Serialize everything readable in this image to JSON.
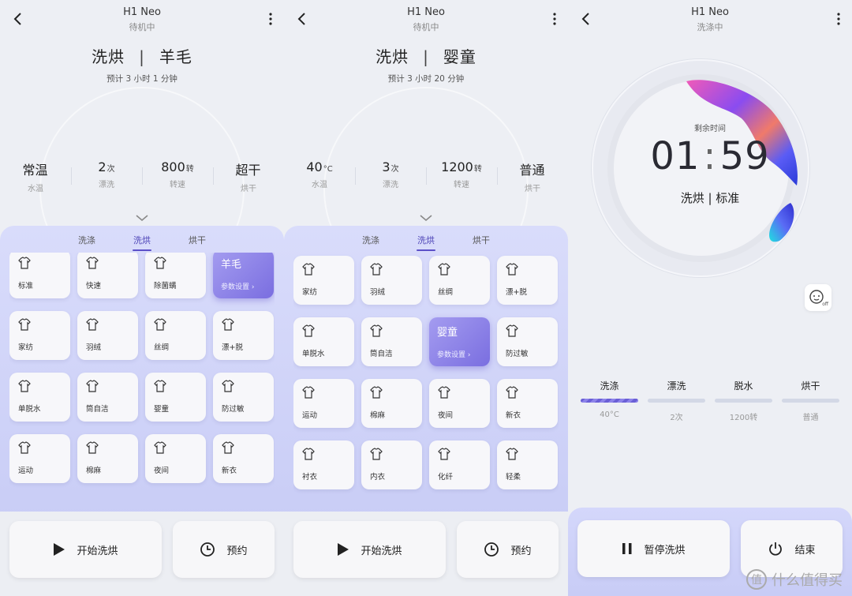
{
  "screen1": {
    "device": "H1 Neo",
    "status": "待机中",
    "mode_main": "洗烘",
    "mode_sub": "羊毛",
    "estimate": "预计 3 小时 1 分钟",
    "params": [
      {
        "value": "常温",
        "unit": "",
        "label": "水温"
      },
      {
        "value": "2",
        "unit": "次",
        "label": "漂洗"
      },
      {
        "value": "800",
        "unit": "转",
        "label": "转速"
      },
      {
        "value": "超干",
        "unit": "",
        "label": "烘干"
      }
    ],
    "tabs": [
      "洗涤",
      "洗烘",
      "烘干"
    ],
    "active_tab": "洗烘",
    "programs": [
      "标准",
      "快速",
      "除菌螨",
      "羊毛",
      "家纺",
      "羽绒",
      "丝绸",
      "漂+脱",
      "单脱水",
      "筒自洁",
      "婴童",
      "防过敏",
      "运动",
      "棉麻",
      "夜间",
      "新衣"
    ],
    "selected": {
      "name": "羊毛",
      "sub": "参数设置 ›"
    },
    "start_label": "开始洗烘",
    "reserve_label": "预约"
  },
  "screen2": {
    "device": "H1 Neo",
    "status": "待机中",
    "mode_main": "洗烘",
    "mode_sub": "婴童",
    "estimate": "预计 3 小时 20 分钟",
    "params": [
      {
        "value": "40",
        "unit": "°C",
        "label": "水温"
      },
      {
        "value": "3",
        "unit": "次",
        "label": "漂洗"
      },
      {
        "value": "1200",
        "unit": "转",
        "label": "转速"
      },
      {
        "value": "普通",
        "unit": "",
        "label": "烘干"
      }
    ],
    "tabs": [
      "洗涤",
      "洗烘",
      "烘干"
    ],
    "active_tab": "洗烘",
    "programs": [
      "家纺",
      "羽绒",
      "丝绸",
      "漂+脱",
      "单脱水",
      "筒自洁",
      "婴童",
      "防过敏",
      "运动",
      "棉麻",
      "夜间",
      "新衣",
      "衬衣",
      "内衣",
      "化纤",
      "轻柔"
    ],
    "selected": {
      "name": "婴童",
      "sub": "参数设置 ›"
    },
    "start_label": "开始洗烘",
    "reserve_label": "预约"
  },
  "screen3": {
    "device": "H1 Neo",
    "status": "洗涤中",
    "remaining_label": "剩余时间",
    "hours": "01",
    "minutes": "59",
    "program": "洗烘 | 标准",
    "badge": "off",
    "stages": [
      {
        "name": "洗涤",
        "value": "40°C",
        "active": true
      },
      {
        "name": "漂洗",
        "value": "2次",
        "active": false
      },
      {
        "name": "脱水",
        "value": "1200转",
        "active": false
      },
      {
        "name": "烘干",
        "value": "普通",
        "active": false
      }
    ],
    "pause_label": "暂停洗烘",
    "end_label": "结束",
    "watermark": "什么值得买",
    "watermark_logo": "值"
  },
  "colors": {
    "accent": "#5b50c8",
    "panel": "#d9dcfb"
  }
}
